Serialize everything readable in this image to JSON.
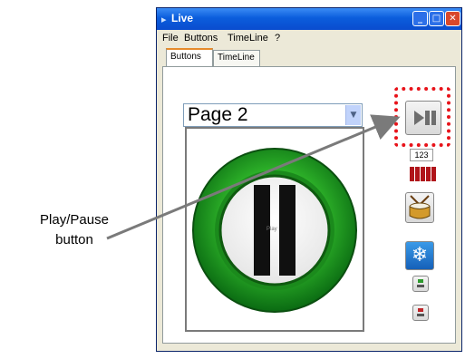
{
  "window": {
    "title": "Live"
  },
  "menu": [
    "File",
    "Buttons",
    "TimeLine",
    "?"
  ],
  "tabs": [
    "Buttons",
    "TimeLine"
  ],
  "page_select": {
    "value": "Page 2"
  },
  "side_panel": {
    "counter_text": "123"
  },
  "canvas_button": {
    "small_label": "Play"
  },
  "callout": {
    "line1": "Play/Pause",
    "line2": "button"
  },
  "colors": {
    "highlight": "#e8131a",
    "green_ring": "#2fb52a",
    "snow_button": "#1f7fd6",
    "meter_red": "#b0141a"
  }
}
